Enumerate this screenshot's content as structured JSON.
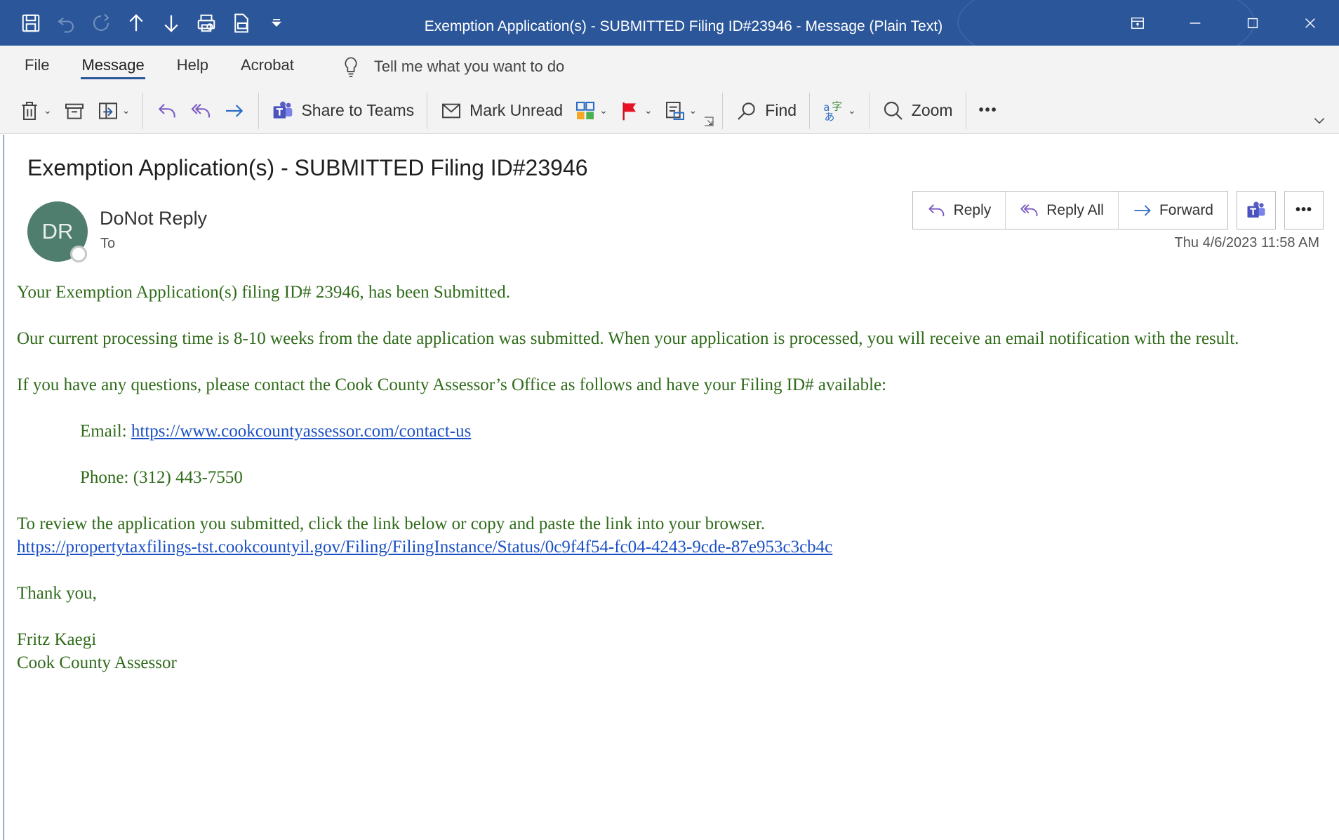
{
  "window": {
    "title": "Exemption Application(s) - SUBMITTED Filing ID#23946  -  Message (Plain Text)"
  },
  "qat_icons": [
    "save-icon",
    "undo-icon",
    "redo-icon",
    "previous-item-icon",
    "next-item-icon",
    "print-icon",
    "print-preview-icon",
    "customize-qat-icon"
  ],
  "menu": {
    "tabs": [
      "File",
      "Message",
      "Help",
      "Acrobat"
    ],
    "active_tab": "Message",
    "tell_me": "Tell me what you want to do"
  },
  "ribbon": {
    "share_to_teams": "Share to Teams",
    "mark_unread": "Mark Unread",
    "find": "Find",
    "zoom": "Zoom",
    "more": "•••"
  },
  "message": {
    "subject": "Exemption Application(s) - SUBMITTED Filing ID#23946",
    "avatar_initials": "DR",
    "sender": "DoNot Reply",
    "to_label": "To",
    "timestamp": "Thu 4/6/2023 11:58 AM",
    "actions": {
      "reply": "Reply",
      "reply_all": "Reply All",
      "forward": "Forward",
      "more": "•••"
    },
    "body": {
      "line1": "Your Exemption Application(s) filing ID# 23946, has been Submitted.",
      "line2": "Our current processing time is 8-10 weeks from the date application was submitted. When your application is processed, you will receive an email notification with the result.",
      "line3": "If you have any questions, please contact the Cook County Assessor’s Office as follows and have your Filing ID# available:",
      "email_label": "Email: ",
      "email_link": "https://www.cookcountyassessor.com/contact-us",
      "phone": "Phone: (312) 443-7550",
      "review_text": "To review the application you submitted, click the link below or copy and paste the link into your browser.",
      "review_link": "https://propertytaxfilings-tst.cookcountyil.gov/Filing/FilingInstance/Status/0c9f4f54-fc04-4243-9cde-87e953c3cb4c",
      "thanks": "Thank you,",
      "sig_name": "Fritz Kaegi",
      "sig_title": "Cook County Assessor"
    }
  },
  "colors": {
    "titlebar": "#2b579a",
    "body_text": "#2f6b1a",
    "link": "#1a4fc4",
    "avatar": "#4f7d6e"
  }
}
